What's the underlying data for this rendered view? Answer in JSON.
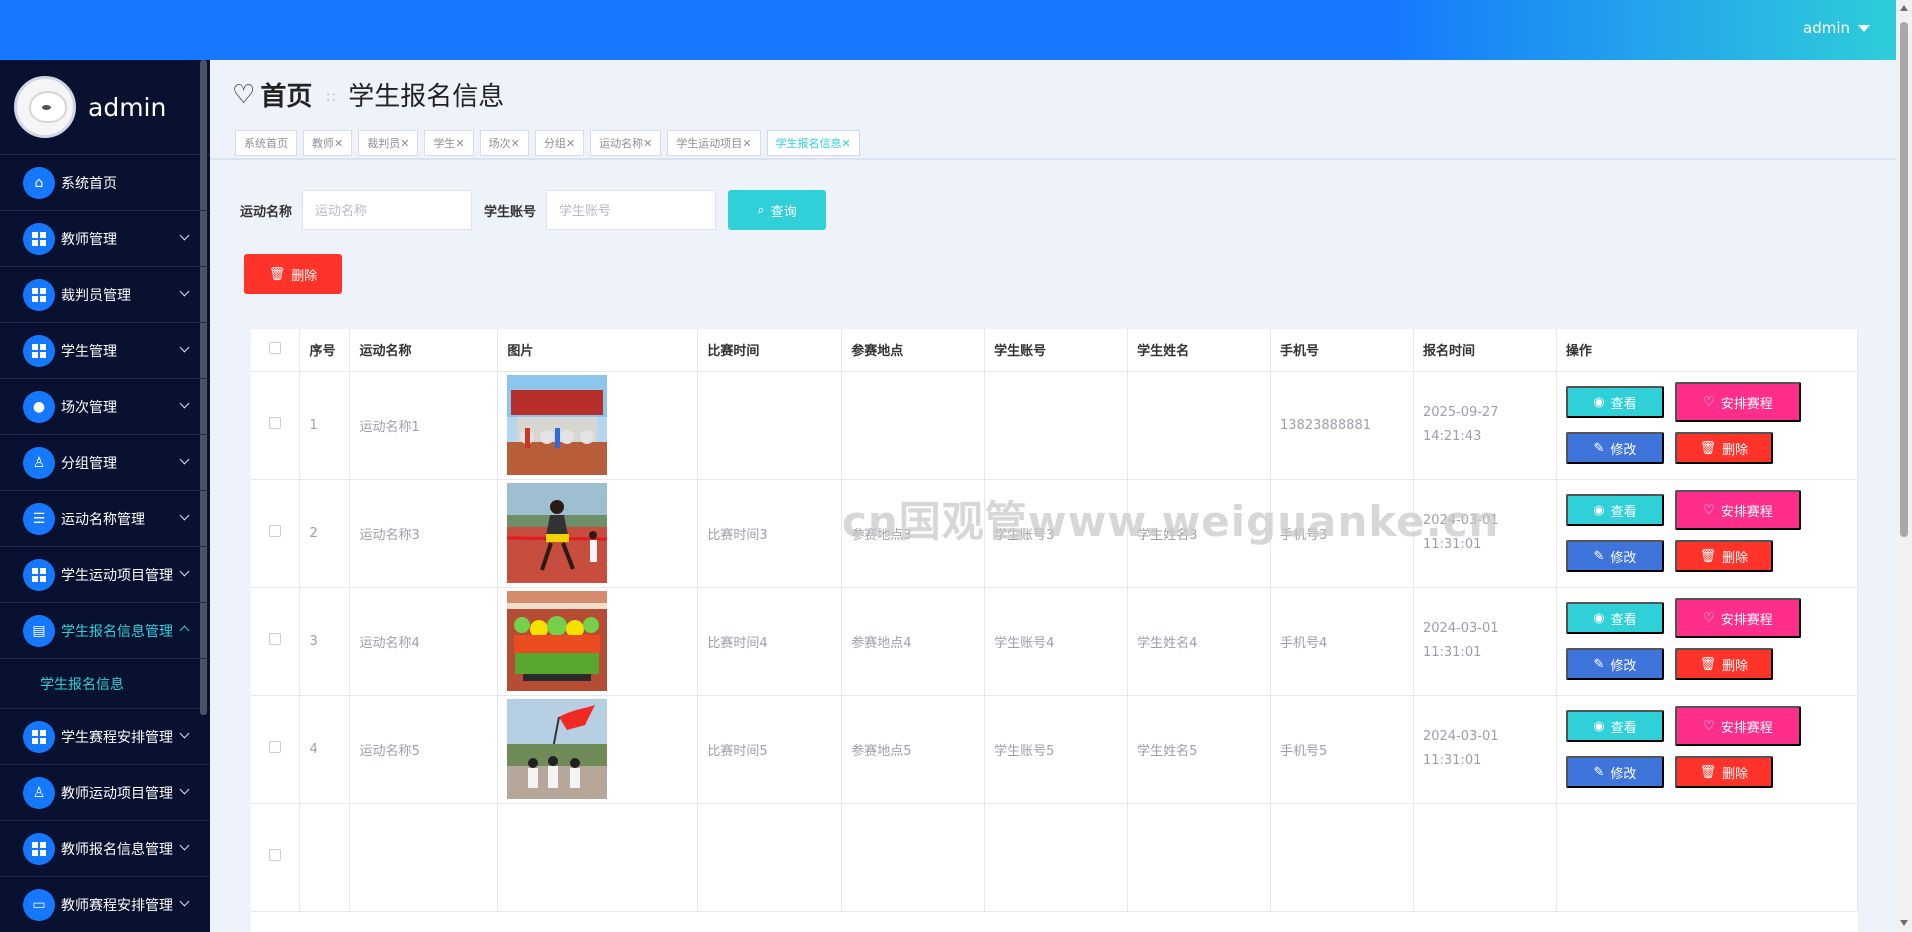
{
  "header": {
    "user": "admin"
  },
  "sidebar": {
    "username": "admin",
    "items": [
      {
        "label": "系统首页",
        "icon": "home-icon"
      },
      {
        "label": "教师管理",
        "icon": "grid-icon"
      },
      {
        "label": "裁判员管理",
        "icon": "grid-icon"
      },
      {
        "label": "学生管理",
        "icon": "grid-icon"
      },
      {
        "label": "场次管理",
        "icon": "bulb-icon"
      },
      {
        "label": "分组管理",
        "icon": "user-icon"
      },
      {
        "label": "运动名称管理",
        "icon": "list-icon"
      },
      {
        "label": "学生运动项目管理",
        "icon": "grid-icon"
      },
      {
        "label": "学生报名信息管理",
        "icon": "document-icon"
      },
      {
        "label": "学生赛程安排管理",
        "icon": "grid-icon"
      },
      {
        "label": "教师运动项目管理",
        "icon": "user-icon"
      },
      {
        "label": "教师报名信息管理",
        "icon": "grid-icon"
      },
      {
        "label": "教师赛程安排管理",
        "icon": "monitor-icon"
      }
    ],
    "submenu": "学生报名信息"
  },
  "breadcrumb": {
    "home": "首页",
    "sep": "∷",
    "current": "学生报名信息"
  },
  "tabs": [
    "系统首页",
    "教师",
    "裁判员",
    "学生",
    "场次",
    "分组",
    "运动名称",
    "学生运动项目",
    "学生报名信息"
  ],
  "search": {
    "sport_label": "运动名称",
    "sport_placeholder": "运动名称",
    "account_label": "学生账号",
    "account_placeholder": "学生账号",
    "query_label": "查询"
  },
  "toolbar": {
    "delete_label": "删除"
  },
  "table": {
    "headers": [
      "序号",
      "运动名称",
      "图片",
      "比赛时间",
      "参赛地点",
      "学生账号",
      "学生姓名",
      "手机号",
      "报名时间",
      "操作"
    ],
    "actions": {
      "view": "查看",
      "schedule": "安排赛程",
      "edit": "修改",
      "delete": "删除"
    },
    "rows": [
      {
        "no": "1",
        "sport": "运动名称1",
        "time": "",
        "place": "",
        "account": "",
        "name": "",
        "phone": "13823888881",
        "reg_time": "2025-09-27 14:21:43"
      },
      {
        "no": "2",
        "sport": "运动名称3",
        "time": "比赛时间3",
        "place": "参赛地点3",
        "account": "学生账号3",
        "name": "学生姓名3",
        "phone": "手机号3",
        "reg_time": "2024-03-01 11:31:01"
      },
      {
        "no": "3",
        "sport": "运动名称4",
        "time": "比赛时间4",
        "place": "参赛地点4",
        "account": "学生账号4",
        "name": "学生姓名4",
        "phone": "手机号4",
        "reg_time": "2024-03-01 11:31:01"
      },
      {
        "no": "4",
        "sport": "运动名称5",
        "time": "比赛时间5",
        "place": "参赛地点5",
        "account": "学生账号5",
        "name": "学生姓名5",
        "phone": "手机号5",
        "reg_time": "2024-03-01 11:31:01"
      }
    ]
  },
  "watermark": "cn国观管www.weiguanke.cn"
}
